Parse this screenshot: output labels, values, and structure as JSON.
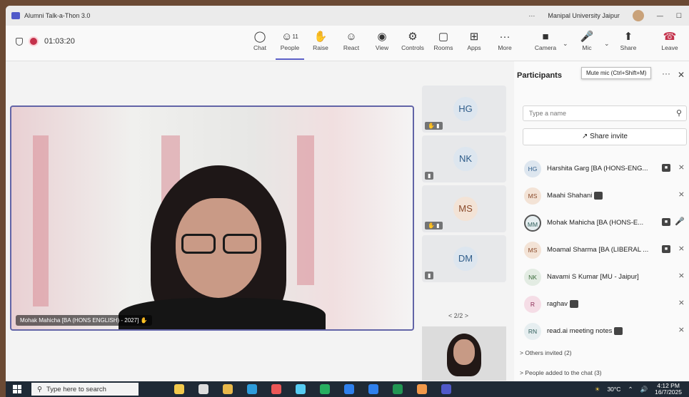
{
  "window": {
    "title": "Alumni Talk-a-Thon 3.0",
    "org": "Manipal University Jaipur"
  },
  "toolbar": {
    "timer": "01:03:20",
    "buttons": [
      {
        "label": "Chat",
        "icon": "chat-icon"
      },
      {
        "label": "People",
        "icon": "people-icon",
        "badge": "11"
      },
      {
        "label": "Raise",
        "icon": "raise-hand-icon"
      },
      {
        "label": "React",
        "icon": "react-icon"
      },
      {
        "label": "View",
        "icon": "view-icon"
      },
      {
        "label": "Controls",
        "icon": "controls-icon"
      },
      {
        "label": "Rooms",
        "icon": "rooms-icon"
      },
      {
        "label": "Apps",
        "icon": "apps-icon"
      },
      {
        "label": "More",
        "icon": "more-icon"
      },
      {
        "label": "Camera",
        "icon": "camera-icon"
      },
      {
        "label": "Mic",
        "icon": "mic-icon"
      },
      {
        "label": "Share",
        "icon": "share-icon"
      },
      {
        "label": "Leave",
        "icon": "leave-icon"
      }
    ],
    "tooltip": "Mute mic (Ctrl+Shift+M)"
  },
  "stage": {
    "main_label": "Mohak Mahicha [BA (HONS ENGLISH) - 2027]",
    "tiles": [
      "HG",
      "NK",
      "MS",
      "DM"
    ],
    "pager": "2/2"
  },
  "participants": {
    "title": "Participants",
    "search_placeholder": "Type a name",
    "share_invite": "Share invite",
    "list": [
      {
        "initials": "HG",
        "name": "Harshita Garg [BA (HONS-ENG...",
        "cam": true
      },
      {
        "initials": "MS",
        "name": "Maahi Shahani",
        "cam": true
      },
      {
        "initials": "MM",
        "name": "Mohak Mahicha [BA (HONS-E...",
        "cam": true
      },
      {
        "initials": "MS",
        "name": "Moamal Sharma [BA (LIBERAL ...",
        "cam": true
      },
      {
        "initials": "NK",
        "name": "Navami S Kumar [MU - Jaipur]",
        "cam": false
      },
      {
        "initials": "R",
        "name": "raghav",
        "cam": true
      },
      {
        "initials": "RN",
        "name": "read.ai meeting notes",
        "cam": true
      }
    ],
    "others_invited": "Others invited (2)",
    "added_to_chat": "People added to the chat (3)"
  },
  "taskbar": {
    "search": "Type here to search",
    "temp": "30°C",
    "time": "4:12 PM",
    "date": "16/7/2025"
  },
  "colors": {
    "accent": "#5b5fc7",
    "leave": "#c4314b"
  }
}
